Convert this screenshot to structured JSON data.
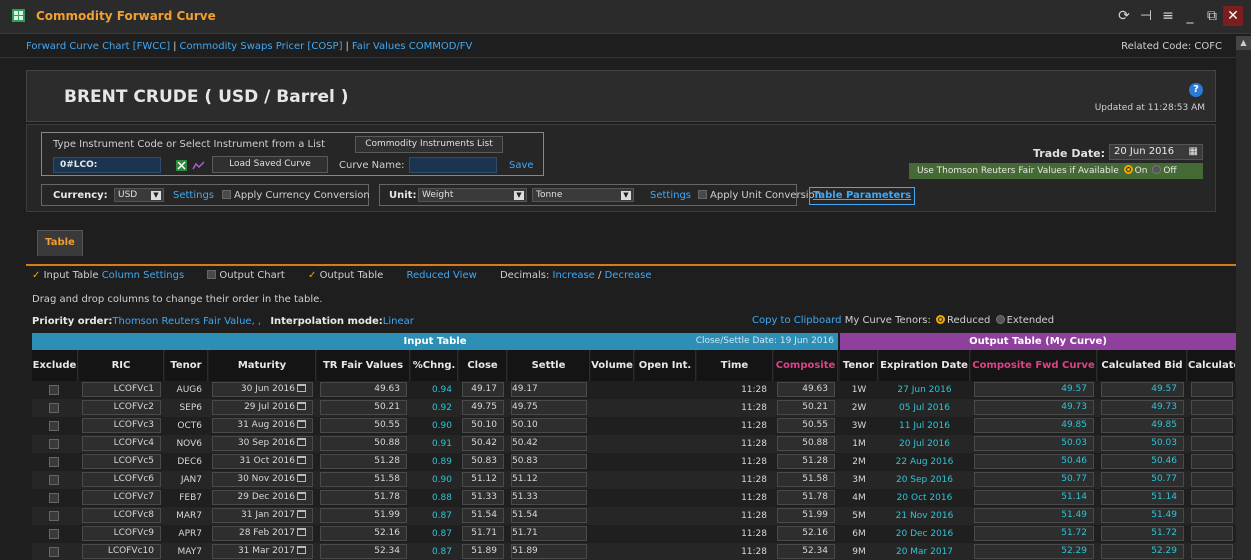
{
  "window": {
    "title": "Commodity Forward Curve",
    "icons": [
      "app-grid-icon",
      "refresh-icon",
      "layout-icon",
      "menu-icon",
      "minimize-icon",
      "restore-icon",
      "close-icon"
    ]
  },
  "links": {
    "items": [
      "Forward Curve Chart [FWCC]",
      "Commodity Swaps Pricer [COSP]",
      "Fair Values COMMOD/FV"
    ],
    "separator": "|",
    "related_code": "Related Code: COFC"
  },
  "header": {
    "title": "BRENT CRUDE ( USD / Barrel )",
    "updated": "Updated at 11:28:53 AM"
  },
  "instrument": {
    "prompt": "Type Instrument Code or Select Instrument from a List",
    "list_button": "Commodity Instruments List",
    "code_value": "0#LCO:",
    "load_button": "Load Saved Curve",
    "curve_name_label": "Curve Name:",
    "curve_name_value": "",
    "save_link": "Save"
  },
  "currency": {
    "label": "Currency:",
    "value": "USD",
    "settings": "Settings",
    "apply": "Apply Currency Conversion"
  },
  "unit": {
    "label": "Unit:",
    "value": "Weight",
    "sub_value": "Tonne",
    "settings": "Settings",
    "apply": "Apply Unit Conversion"
  },
  "table_parameters": "Table Parameters",
  "trade_date": {
    "label": "Trade Date:",
    "value": "20 Jun 2016",
    "tr_fair_label": "Use Thomson Reuters Fair Values if Available",
    "on": "On",
    "off": "Off"
  },
  "tab": {
    "label": "Table"
  },
  "options": {
    "input_table": "Input Table",
    "column_settings": "Column Settings",
    "output_chart": "Output Chart",
    "output_table": "Output Table",
    "reduced_view": "Reduced View",
    "decimals": "Decimals:",
    "increase": "Increase",
    "slash": "/",
    "decrease": "Decrease"
  },
  "drag_note": "Drag and drop columns to change their order in the table.",
  "priority": {
    "label": "Priority order:",
    "value": "Thomson Reuters Fair Value, ,",
    "interp_label": "Interpolation mode:",
    "interp_value": "Linear"
  },
  "copy": {
    "link": "Copy to Clipboard",
    "tenors_label": "My Curve Tenors:",
    "reduced": "Reduced",
    "extended": "Extended"
  },
  "input_table": {
    "band_title": "Input Table",
    "close_settle": "Close/Settle Date: 19 Jun 2016",
    "headers": [
      "Exclude",
      "RIC",
      "Tenor",
      "Maturity",
      "TR Fair Values",
      "%Chng.",
      "Close",
      "Settle",
      "Volume",
      "Open Int.",
      "Time",
      "Composite"
    ],
    "rows": [
      {
        "ric": "LCOFVc1",
        "tenor": "AUG6",
        "maturity": "30 Jun 2016",
        "tr": "49.63",
        "chg": "0.94",
        "close": "49.17",
        "settle": "49.17",
        "time": "11:28",
        "comp": "49.63"
      },
      {
        "ric": "LCOFVc2",
        "tenor": "SEP6",
        "maturity": "29 Jul 2016",
        "tr": "50.21",
        "chg": "0.92",
        "close": "49.75",
        "settle": "49.75",
        "time": "11:28",
        "comp": "50.21"
      },
      {
        "ric": "LCOFVc3",
        "tenor": "OCT6",
        "maturity": "31 Aug 2016",
        "tr": "50.55",
        "chg": "0.90",
        "close": "50.10",
        "settle": "50.10",
        "time": "11:28",
        "comp": "50.55"
      },
      {
        "ric": "LCOFVc4",
        "tenor": "NOV6",
        "maturity": "30 Sep 2016",
        "tr": "50.88",
        "chg": "0.91",
        "close": "50.42",
        "settle": "50.42",
        "time": "11:28",
        "comp": "50.88"
      },
      {
        "ric": "LCOFVc5",
        "tenor": "DEC6",
        "maturity": "31 Oct 2016",
        "tr": "51.28",
        "chg": "0.89",
        "close": "50.83",
        "settle": "50.83",
        "time": "11:28",
        "comp": "51.28"
      },
      {
        "ric": "LCOFVc6",
        "tenor": "JAN7",
        "maturity": "30 Nov 2016",
        "tr": "51.58",
        "chg": "0.90",
        "close": "51.12",
        "settle": "51.12",
        "time": "11:28",
        "comp": "51.58"
      },
      {
        "ric": "LCOFVc7",
        "tenor": "FEB7",
        "maturity": "29 Dec 2016",
        "tr": "51.78",
        "chg": "0.88",
        "close": "51.33",
        "settle": "51.33",
        "time": "11:28",
        "comp": "51.78"
      },
      {
        "ric": "LCOFVc8",
        "tenor": "MAR7",
        "maturity": "31 Jan 2017",
        "tr": "51.99",
        "chg": "0.87",
        "close": "51.54",
        "settle": "51.54",
        "time": "11:28",
        "comp": "51.99"
      },
      {
        "ric": "LCOFVc9",
        "tenor": "APR7",
        "maturity": "28 Feb 2017",
        "tr": "52.16",
        "chg": "0.87",
        "close": "51.71",
        "settle": "51.71",
        "time": "11:28",
        "comp": "52.16"
      },
      {
        "ric": "LCOFVc10",
        "tenor": "MAY7",
        "maturity": "31 Mar 2017",
        "tr": "52.34",
        "chg": "0.87",
        "close": "51.89",
        "settle": "51.89",
        "time": "11:28",
        "comp": "52.34"
      }
    ]
  },
  "output_table": {
    "band_title": "Output Table (My Curve)",
    "headers": [
      "Tenor",
      "Expiration Date",
      "Composite Fwd Curve",
      "Calculated Bid",
      "Calculate"
    ],
    "rows": [
      {
        "tenor": "1W",
        "exp": "27 Jun 2016",
        "comp": "49.57",
        "bid": "49.57"
      },
      {
        "tenor": "2W",
        "exp": "05 Jul 2016",
        "comp": "49.73",
        "bid": "49.73"
      },
      {
        "tenor": "3W",
        "exp": "11 Jul 2016",
        "comp": "49.85",
        "bid": "49.85"
      },
      {
        "tenor": "1M",
        "exp": "20 Jul 2016",
        "comp": "50.03",
        "bid": "50.03"
      },
      {
        "tenor": "2M",
        "exp": "22 Aug 2016",
        "comp": "50.46",
        "bid": "50.46"
      },
      {
        "tenor": "3M",
        "exp": "20 Sep 2016",
        "comp": "50.77",
        "bid": "50.77"
      },
      {
        "tenor": "4M",
        "exp": "20 Oct 2016",
        "comp": "51.14",
        "bid": "51.14"
      },
      {
        "tenor": "5M",
        "exp": "21 Nov 2016",
        "comp": "51.49",
        "bid": "51.49"
      },
      {
        "tenor": "6M",
        "exp": "20 Dec 2016",
        "comp": "51.72",
        "bid": "51.72"
      },
      {
        "tenor": "9M",
        "exp": "20 Mar 2017",
        "comp": "52.29",
        "bid": "52.29"
      }
    ]
  },
  "colors": {
    "accent": "#f0a030",
    "link": "#3fa9f5",
    "input_band": "#2d8fb5",
    "output_band": "#8f3f9c",
    "teal": "#2ec4d6"
  }
}
